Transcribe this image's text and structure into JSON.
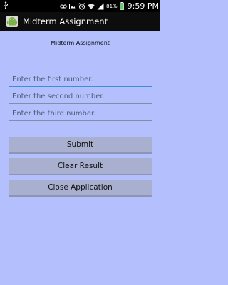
{
  "status_bar": {
    "time": "9:59 PM",
    "battery_percent": "81%",
    "icons": [
      "usb-icon",
      "voicemail-icon",
      "image-icon",
      "alarm-icon",
      "wifi-icon",
      "signal-icon",
      "battery-icon"
    ]
  },
  "title_bar": {
    "app_title": "Midterm Assignment",
    "app_icon": "android-icon"
  },
  "form": {
    "header": "Midterm Assignment",
    "fields": [
      {
        "placeholder": "Enter the first number.",
        "value": ""
      },
      {
        "placeholder": "Enter the second number.",
        "value": ""
      },
      {
        "placeholder": "Enter the third number.",
        "value": ""
      }
    ],
    "buttons": {
      "submit": "Submit",
      "clear": "Clear Result",
      "close": "Close Application"
    }
  },
  "colors": {
    "background": "#b3c0fd",
    "button": "#a9b0cf",
    "focus_accent": "#3a8fd6",
    "title_bar": "#0d0d0d"
  }
}
